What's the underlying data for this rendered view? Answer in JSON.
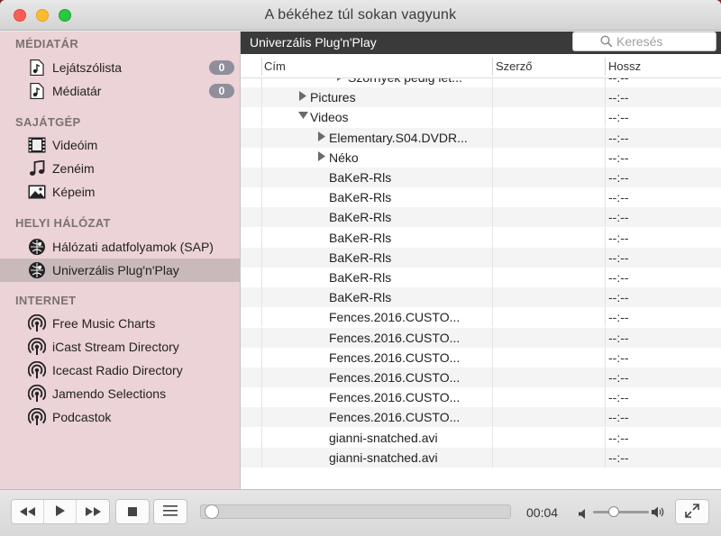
{
  "window": {
    "title": "A békéhez túl sokan vagyunk"
  },
  "sidebar": {
    "sections": [
      {
        "header": "MÉDIATÁR",
        "items": [
          {
            "label": "Lejátszólista",
            "icon": "music-file-icon",
            "badge": "0"
          },
          {
            "label": "Médiatár",
            "icon": "music-file-icon",
            "badge": "0"
          }
        ]
      },
      {
        "header": "SAJÁTGÉP",
        "items": [
          {
            "label": "Videóim",
            "icon": "film-icon"
          },
          {
            "label": "Zenéim",
            "icon": "music-note-icon"
          },
          {
            "label": "Képeim",
            "icon": "picture-icon"
          }
        ]
      },
      {
        "header": "HELYI HÁLÓZAT",
        "items": [
          {
            "label": "Hálózati adatfolyamok (SAP)",
            "icon": "network-globe-icon"
          },
          {
            "label": "Univerzális Plug'n'Play",
            "icon": "network-globe-icon",
            "selected": true
          }
        ]
      },
      {
        "header": "INTERNET",
        "items": [
          {
            "label": "Free Music Charts",
            "icon": "podcast-icon"
          },
          {
            "label": "iCast Stream Directory",
            "icon": "podcast-icon"
          },
          {
            "label": "Icecast Radio Directory",
            "icon": "podcast-icon"
          },
          {
            "label": "Jamendo Selections",
            "icon": "podcast-icon"
          },
          {
            "label": "Podcastok",
            "icon": "podcast-icon"
          }
        ]
      }
    ]
  },
  "main": {
    "title": "Univerzális Plug'n'Play",
    "search": {
      "placeholder": "Keresés",
      "value": ""
    },
    "columns": [
      "Cím",
      "Szerző",
      "Hossz"
    ],
    "rows": [
      {
        "title": "Szörnyek pedig lét...",
        "disclosure": "right",
        "indent": 3,
        "author": "",
        "duration": "--:--",
        "partial": true
      },
      {
        "title": "Pictures",
        "disclosure": "right",
        "indent": 1,
        "author": "",
        "duration": "--:--"
      },
      {
        "title": "Videos",
        "disclosure": "down",
        "indent": 1,
        "author": "",
        "duration": "--:--"
      },
      {
        "title": "Elementary.S04.DVDR...",
        "disclosure": "right",
        "indent": 2,
        "author": "",
        "duration": "--:--"
      },
      {
        "title": "Néko",
        "disclosure": "right",
        "indent": 2,
        "author": "",
        "duration": "--:--"
      },
      {
        "title": "BaKeR-Rls",
        "disclosure": "",
        "indent": 2,
        "author": "",
        "duration": "--:--"
      },
      {
        "title": "BaKeR-Rls",
        "disclosure": "",
        "indent": 2,
        "author": "",
        "duration": "--:--"
      },
      {
        "title": "BaKeR-Rls",
        "disclosure": "",
        "indent": 2,
        "author": "",
        "duration": "--:--"
      },
      {
        "title": "BaKeR-Rls",
        "disclosure": "",
        "indent": 2,
        "author": "",
        "duration": "--:--"
      },
      {
        "title": "BaKeR-Rls",
        "disclosure": "",
        "indent": 2,
        "author": "",
        "duration": "--:--"
      },
      {
        "title": "BaKeR-Rls",
        "disclosure": "",
        "indent": 2,
        "author": "",
        "duration": "--:--"
      },
      {
        "title": "BaKeR-Rls",
        "disclosure": "",
        "indent": 2,
        "author": "",
        "duration": "--:--"
      },
      {
        "title": "Fences.2016.CUSTO...",
        "disclosure": "",
        "indent": 2,
        "author": "",
        "duration": "--:--"
      },
      {
        "title": "Fences.2016.CUSTO...",
        "disclosure": "",
        "indent": 2,
        "author": "",
        "duration": "--:--"
      },
      {
        "title": "Fences.2016.CUSTO...",
        "disclosure": "",
        "indent": 2,
        "author": "",
        "duration": "--:--"
      },
      {
        "title": "Fences.2016.CUSTO...",
        "disclosure": "",
        "indent": 2,
        "author": "",
        "duration": "--:--"
      },
      {
        "title": "Fences.2016.CUSTO...",
        "disclosure": "",
        "indent": 2,
        "author": "",
        "duration": "--:--"
      },
      {
        "title": "Fences.2016.CUSTO...",
        "disclosure": "",
        "indent": 2,
        "author": "",
        "duration": "--:--"
      },
      {
        "title": "gianni-snatched.avi",
        "disclosure": "",
        "indent": 2,
        "author": "",
        "duration": "--:--"
      },
      {
        "title": "gianni-snatched.avi",
        "disclosure": "",
        "indent": 2,
        "author": "",
        "duration": "--:--"
      }
    ]
  },
  "controls": {
    "time": "00:04",
    "progress_fraction": 0.0,
    "volume_fraction": 0.35,
    "buttons": [
      "rewind-button",
      "play-button",
      "fast-forward-button",
      "stop-button",
      "playlist-toggle-button",
      "fullscreen-button"
    ]
  },
  "colors": {
    "sidebar_bg": "#ecd3d7",
    "sidebar_selected": "#c9b9bb",
    "header_bar": "#3a3a3a",
    "badge": "#8f8f9c"
  }
}
